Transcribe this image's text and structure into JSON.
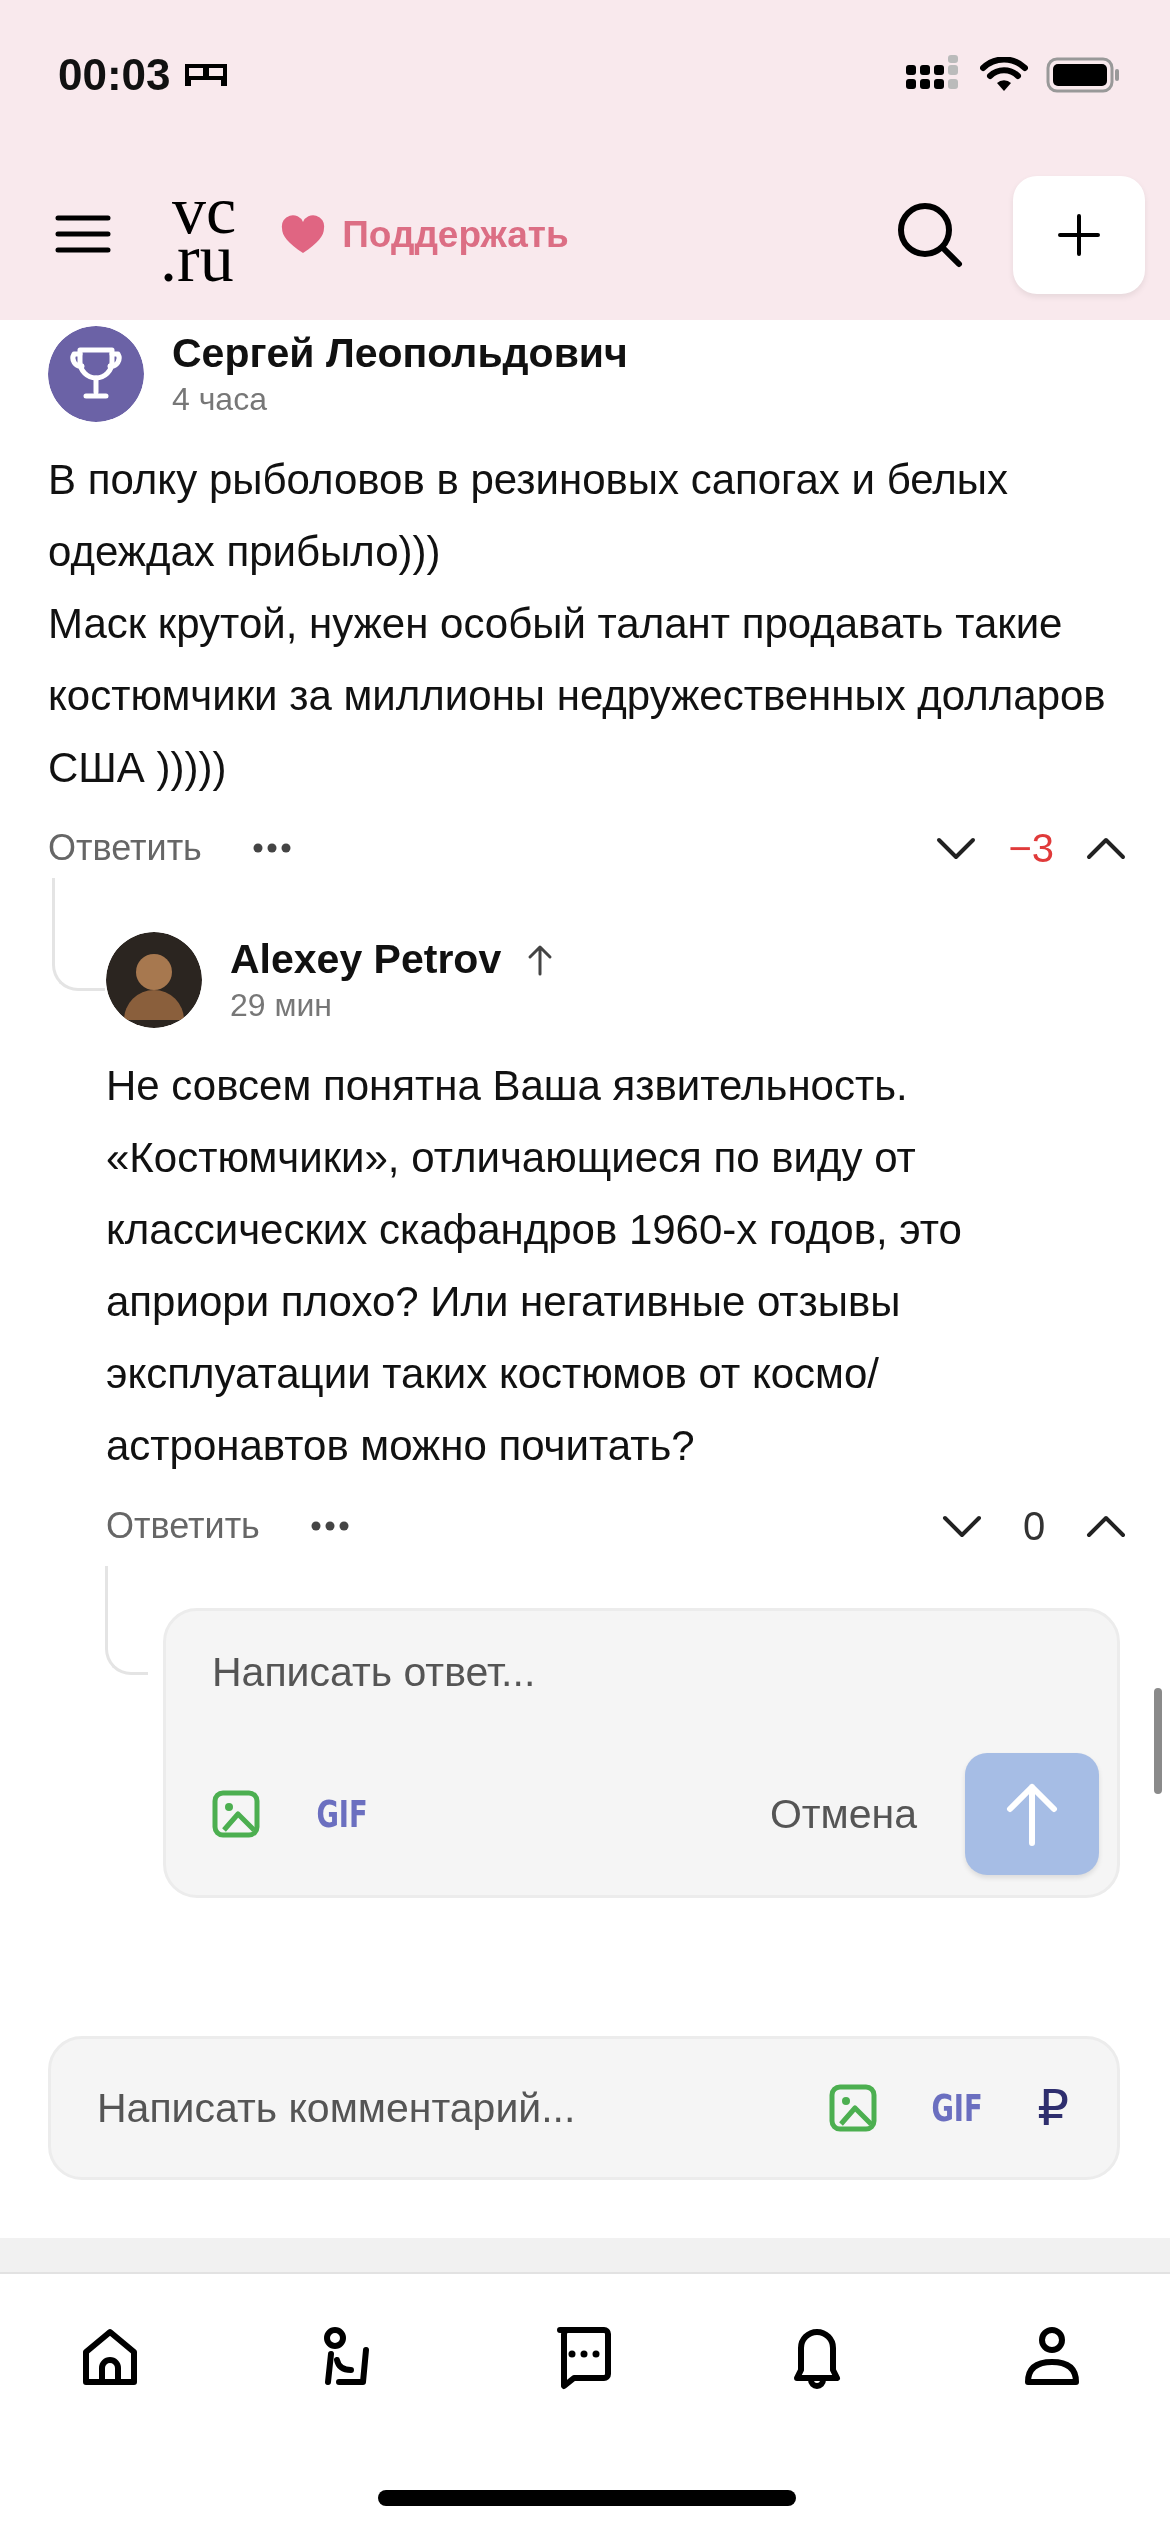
{
  "status_bar": {
    "time": "00:03"
  },
  "header": {
    "logo_top": "vc",
    "logo_bottom": ".ru",
    "support": "Поддержать"
  },
  "comments": [
    {
      "author": "Сергей Леопольдович",
      "reply_to_arrow": false,
      "time": "4 часа",
      "paragraphs": [
        "В полку рыболовов в резиновых сапогах и белых одеждах прибыло)))",
        "Маск крутой, нужен особый талант продавать такие костюмчики за миллионы недружественных долларов США )))))"
      ],
      "reply": "Ответить",
      "score": "−3",
      "color": "#e03a3a",
      "children": [
        {
          "author": "Alexey Petrov",
          "reply_to_arrow": true,
          "time": "29 мин",
          "paragraphs": [
            "Не совсем понятна Ваша язвительность. «Костюмчики», отличающиеся по виду от классических скафандров 1960-х годов, это априори плохо? Или негативные отзывы эксплуатации таких костюмов от космо/астронавтов можно почитать?"
          ],
          "reply": "Ответить",
          "score": "0",
          "color": "#333333"
        }
      ]
    }
  ],
  "reply_box": {
    "placeholder": "Написать ответ...",
    "gif": "GIF",
    "cancel": "Отмена"
  },
  "comment_field": {
    "placeholder": "Написать комментарий...",
    "gif": "GIF",
    "currency": "₽"
  }
}
